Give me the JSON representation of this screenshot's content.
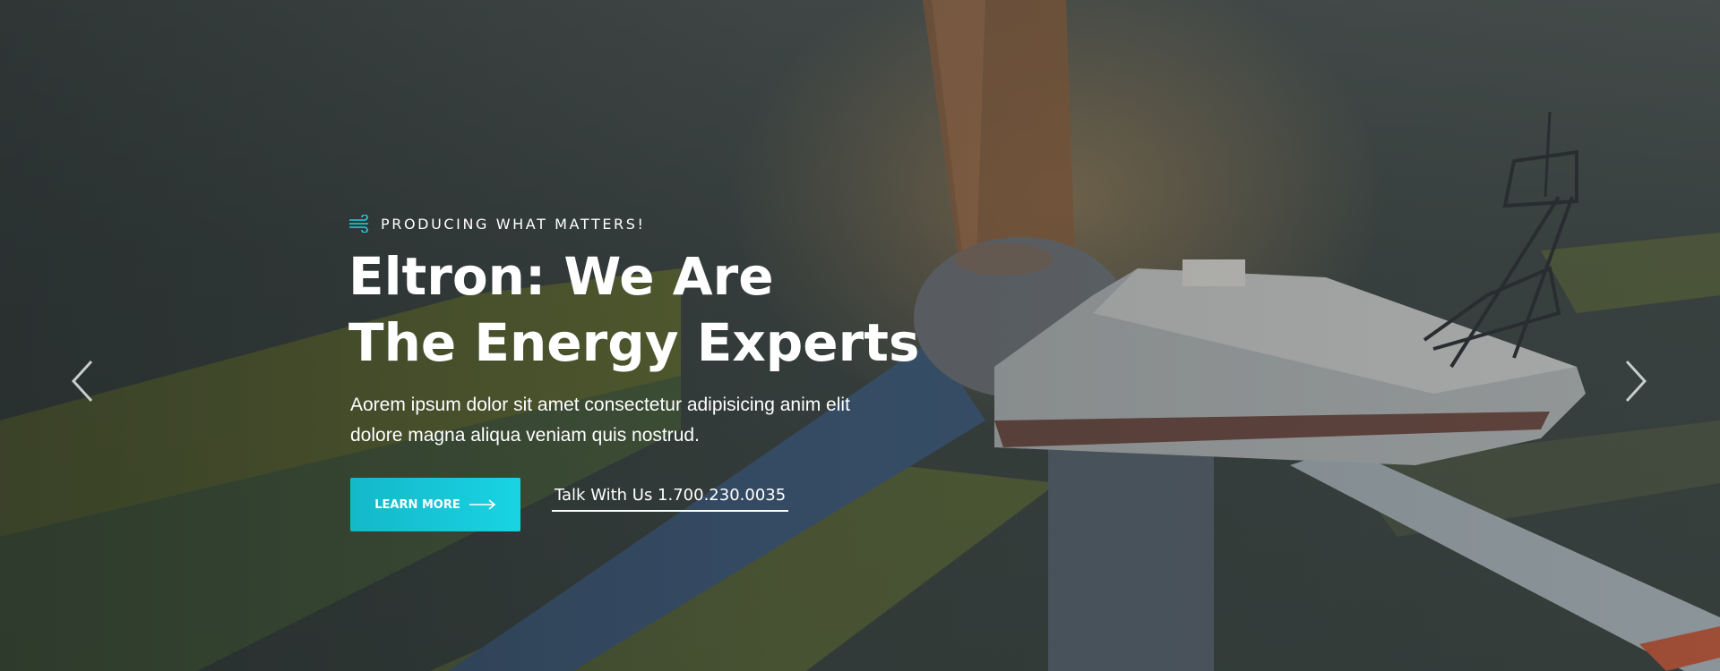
{
  "hero": {
    "tagline": "PRODUCING WHAT MATTERS!",
    "tagline_icon": "wind-icon",
    "headline_line1": "Eltron: We Are",
    "headline_line2": "The Energy Experts",
    "description": "Aorem ipsum dolor sit amet consectetur adipisicing anim elit dolore magna aliqua veniam quis nostrud.",
    "cta_label": "LEARN MORE",
    "cta_icon": "arrow-right-icon",
    "phone_link": "Talk With Us 1.700.230.0035"
  },
  "slider": {
    "prev_icon": "chevron-left-icon",
    "next_icon": "chevron-right-icon"
  },
  "colors": {
    "accent": "#19d3e3",
    "text": "#ffffff"
  }
}
